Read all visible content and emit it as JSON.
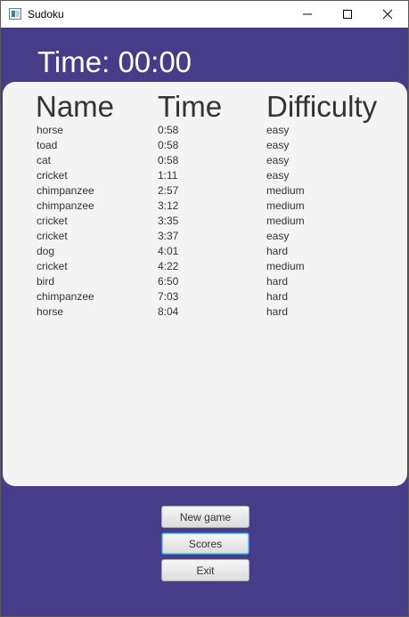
{
  "window": {
    "title": "Sudoku"
  },
  "timer": {
    "text": "Time: 00:00"
  },
  "scores": {
    "headers": {
      "name": "Name",
      "time": "Time",
      "difficulty": "Difficulty"
    },
    "rows": [
      {
        "name": "horse",
        "time": "0:58",
        "difficulty": "easy"
      },
      {
        "name": "toad",
        "time": "0:58",
        "difficulty": "easy"
      },
      {
        "name": "cat",
        "time": "0:58",
        "difficulty": "easy"
      },
      {
        "name": "cricket",
        "time": "1:11",
        "difficulty": "easy"
      },
      {
        "name": "chimpanzee",
        "time": "2:57",
        "difficulty": "medium"
      },
      {
        "name": "chimpanzee",
        "time": "3:12",
        "difficulty": "medium"
      },
      {
        "name": "cricket",
        "time": "3:35",
        "difficulty": "medium"
      },
      {
        "name": "cricket",
        "time": "3:37",
        "difficulty": "easy"
      },
      {
        "name": "dog",
        "time": "4:01",
        "difficulty": "hard"
      },
      {
        "name": "cricket",
        "time": "4:22",
        "difficulty": "medium"
      },
      {
        "name": "bird",
        "time": "6:50",
        "difficulty": "hard"
      },
      {
        "name": "chimpanzee",
        "time": "7:03",
        "difficulty": "hard"
      },
      {
        "name": "horse",
        "time": "8:04",
        "difficulty": "hard"
      }
    ]
  },
  "buttons": {
    "new_game": "New game",
    "scores": "Scores",
    "exit": "Exit"
  },
  "colors": {
    "background": "#463c89",
    "panel": "#f4f4f4",
    "focus": "#2f8fd0"
  }
}
